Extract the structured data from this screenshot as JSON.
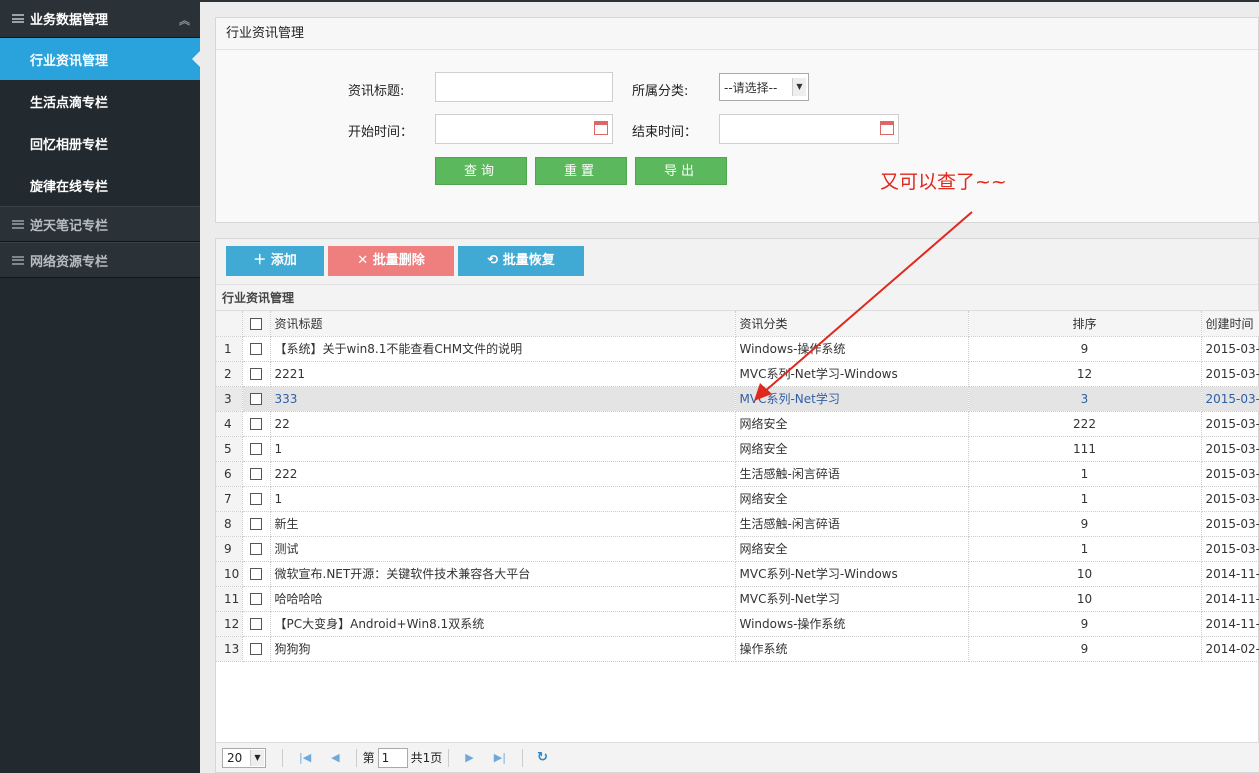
{
  "sidebar": {
    "group1": "业务数据管理",
    "items": [
      {
        "label": "行业资讯管理"
      },
      {
        "label": "生活点滴专栏"
      },
      {
        "label": "回忆相册专栏"
      },
      {
        "label": "旋律在线专栏"
      }
    ],
    "group2": "逆天笔记专栏",
    "group3": "网络资源专栏"
  },
  "search": {
    "title": "行业资讯管理",
    "title_label": "资讯标题:",
    "category_label": "所属分类:",
    "category_selected": "--请选择--",
    "start_label": "开始时间：",
    "end_label": "结束时间：",
    "query_btn": "查询",
    "reset_btn": "重置",
    "export_btn": "导出"
  },
  "annotation": "又可以查了~~",
  "toolbar": {
    "add": "添加",
    "batch_delete": "批量删除",
    "batch_restore": "批量恢复"
  },
  "grid": {
    "caption": "行业资讯管理",
    "headers": [
      "资讯标题",
      "资讯分类",
      "排序",
      "创建时间"
    ],
    "rows": [
      {
        "n": "1",
        "title": "【系统】关于win8.1不能查看CHM文件的说明",
        "category": "Windows-操作系统",
        "order": "9",
        "date": "2015-03-"
      },
      {
        "n": "2",
        "title": "2221",
        "category": "MVC系列-Net学习-Windows",
        "order": "12",
        "date": "2015-03-"
      },
      {
        "n": "3",
        "title": "333",
        "category": "MVC系列-Net学习",
        "order": "3",
        "date": "2015-03-"
      },
      {
        "n": "4",
        "title": "22",
        "category": "网络安全",
        "order": "222",
        "date": "2015-03-"
      },
      {
        "n": "5",
        "title": "1",
        "category": "网络安全",
        "order": "111",
        "date": "2015-03-"
      },
      {
        "n": "6",
        "title": "222",
        "category": "生活感触-闲言碎语",
        "order": "1",
        "date": "2015-03-"
      },
      {
        "n": "7",
        "title": "1",
        "category": "网络安全",
        "order": "1",
        "date": "2015-03-"
      },
      {
        "n": "8",
        "title": "新生",
        "category": "生活感触-闲言碎语",
        "order": "9",
        "date": "2015-03-"
      },
      {
        "n": "9",
        "title": "测试",
        "category": "网络安全",
        "order": "1",
        "date": "2015-03-"
      },
      {
        "n": "10",
        "title": "微软宣布.NET开源：关键软件技术兼容各大平台",
        "category": "MVC系列-Net学习-Windows",
        "order": "10",
        "date": "2014-11-"
      },
      {
        "n": "11",
        "title": "哈哈哈哈",
        "category": "MVC系列-Net学习",
        "order": "10",
        "date": "2014-11-"
      },
      {
        "n": "12",
        "title": "【PC大变身】Android+Win8.1双系统",
        "category": "Windows-操作系统",
        "order": "9",
        "date": "2014-11-"
      },
      {
        "n": "13",
        "title": "狗狗狗",
        "category": "操作系统",
        "order": "9",
        "date": "2014-02-"
      }
    ]
  },
  "pager": {
    "page_size": "20",
    "page_prefix": "第",
    "page_value": "1",
    "total": "共1页"
  },
  "colors": {
    "sidebar_bg": "#222a30",
    "active_item": "#2aa3dc",
    "green_button": "#5cb85c",
    "blue_button": "#40a9d4",
    "red_button": "#ef7f7f",
    "annotation": "#e0281e"
  }
}
